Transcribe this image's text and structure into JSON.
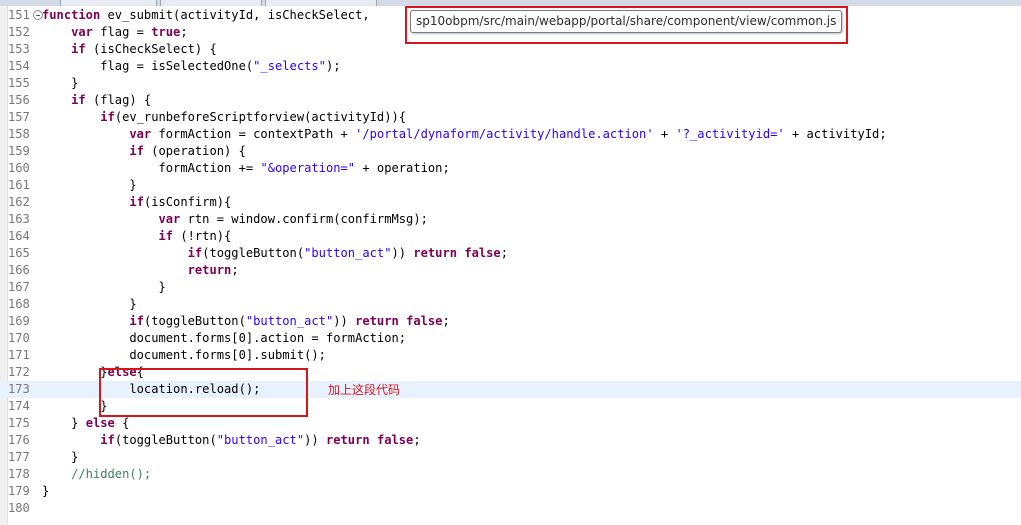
{
  "tooltip": {
    "path": "sp10obpm/src/main/webapp/portal/share/component/view/common.js"
  },
  "annotation": {
    "text": "加上这段代码"
  },
  "editor": {
    "lines": [
      {
        "num": "151",
        "fold": true,
        "tokens": [
          [
            "kw",
            "function"
          ],
          [
            "n",
            " ev_submit(activityId, isCheckSelect,"
          ]
        ]
      },
      {
        "num": "152",
        "tokens": [
          [
            "n",
            "    "
          ],
          [
            "kw",
            "var"
          ],
          [
            "n",
            " flag = "
          ],
          [
            "kw",
            "true"
          ],
          [
            "n",
            ";"
          ]
        ]
      },
      {
        "num": "153",
        "tokens": [
          [
            "n",
            "    "
          ],
          [
            "kw",
            "if"
          ],
          [
            "n",
            " (isCheckSelect) {"
          ]
        ]
      },
      {
        "num": "154",
        "tokens": [
          [
            "n",
            "        flag = isSelectedOne("
          ],
          [
            "str",
            "\"_selects\""
          ],
          [
            "n",
            ");"
          ]
        ]
      },
      {
        "num": "155",
        "tokens": [
          [
            "n",
            "    }"
          ]
        ]
      },
      {
        "num": "156",
        "tokens": [
          [
            "n",
            "    "
          ],
          [
            "kw",
            "if"
          ],
          [
            "n",
            " (flag) {"
          ]
        ]
      },
      {
        "num": "157",
        "tokens": [
          [
            "n",
            "        "
          ],
          [
            "kw",
            "if"
          ],
          [
            "n",
            "(ev_runbeforeScriptforview(activityId)){"
          ]
        ]
      },
      {
        "num": "158",
        "tokens": [
          [
            "n",
            "            "
          ],
          [
            "kw",
            "var"
          ],
          [
            "n",
            " formAction = contextPath + "
          ],
          [
            "str",
            "'/portal/dynaform/activity/handle.action'"
          ],
          [
            "n",
            " + "
          ],
          [
            "str",
            "'?_activityid='"
          ],
          [
            "n",
            " + activityId;"
          ]
        ]
      },
      {
        "num": "159",
        "tokens": [
          [
            "n",
            "            "
          ],
          [
            "kw",
            "if"
          ],
          [
            "n",
            " (operation) {"
          ]
        ]
      },
      {
        "num": "160",
        "tokens": [
          [
            "n",
            "                formAction += "
          ],
          [
            "str",
            "\"&operation=\""
          ],
          [
            "n",
            " + operation;"
          ]
        ]
      },
      {
        "num": "161",
        "tokens": [
          [
            "n",
            "            }"
          ]
        ]
      },
      {
        "num": "162",
        "tokens": [
          [
            "n",
            "            "
          ],
          [
            "kw",
            "if"
          ],
          [
            "n",
            "(isConfirm){"
          ]
        ]
      },
      {
        "num": "163",
        "tokens": [
          [
            "n",
            "                "
          ],
          [
            "kw",
            "var"
          ],
          [
            "n",
            " rtn = window.confirm(confirmMsg);"
          ]
        ]
      },
      {
        "num": "164",
        "tokens": [
          [
            "n",
            "                "
          ],
          [
            "kw",
            "if"
          ],
          [
            "n",
            " (!rtn){"
          ]
        ]
      },
      {
        "num": "165",
        "tokens": [
          [
            "n",
            "                    "
          ],
          [
            "kw",
            "if"
          ],
          [
            "n",
            "(toggleButton("
          ],
          [
            "str",
            "\"button_act\""
          ],
          [
            "n",
            ")) "
          ],
          [
            "kw",
            "return"
          ],
          [
            "n",
            " "
          ],
          [
            "kw",
            "false"
          ],
          [
            "n",
            ";"
          ]
        ]
      },
      {
        "num": "166",
        "tokens": [
          [
            "n",
            "                    "
          ],
          [
            "kw",
            "return"
          ],
          [
            "n",
            ";"
          ]
        ]
      },
      {
        "num": "167",
        "tokens": [
          [
            "n",
            "                }"
          ]
        ]
      },
      {
        "num": "168",
        "tokens": [
          [
            "n",
            "            }"
          ]
        ]
      },
      {
        "num": "169",
        "tokens": [
          [
            "n",
            "            "
          ],
          [
            "kw",
            "if"
          ],
          [
            "n",
            "(toggleButton("
          ],
          [
            "str",
            "\"button_act\""
          ],
          [
            "n",
            ")) "
          ],
          [
            "kw",
            "return"
          ],
          [
            "n",
            " "
          ],
          [
            "kw",
            "false"
          ],
          [
            "n",
            ";"
          ]
        ]
      },
      {
        "num": "170",
        "tokens": [
          [
            "n",
            "            document.forms[0].action = formAction;"
          ]
        ]
      },
      {
        "num": "171",
        "tokens": [
          [
            "n",
            "            document.forms[0].submit();"
          ]
        ]
      },
      {
        "num": "172",
        "tokens": [
          [
            "n",
            "        }"
          ],
          [
            "kw",
            "else"
          ],
          [
            "n",
            "{"
          ]
        ]
      },
      {
        "num": "173",
        "current": true,
        "tokens": [
          [
            "n",
            "            location.reload();"
          ]
        ]
      },
      {
        "num": "174",
        "tokens": [
          [
            "n",
            "        }"
          ]
        ]
      },
      {
        "num": "175",
        "tokens": [
          [
            "n",
            "    } "
          ],
          [
            "kw",
            "else"
          ],
          [
            "n",
            " {"
          ]
        ]
      },
      {
        "num": "176",
        "tokens": [
          [
            "n",
            "        "
          ],
          [
            "kw",
            "if"
          ],
          [
            "n",
            "(toggleButton("
          ],
          [
            "str",
            "\"button_act\""
          ],
          [
            "n",
            ")) "
          ],
          [
            "kw",
            "return"
          ],
          [
            "n",
            " "
          ],
          [
            "kw",
            "false"
          ],
          [
            "n",
            ";"
          ]
        ]
      },
      {
        "num": "177",
        "tokens": [
          [
            "n",
            "    }"
          ]
        ]
      },
      {
        "num": "178",
        "tokens": [
          [
            "n",
            "    "
          ],
          [
            "cm",
            "//hidden();"
          ]
        ]
      },
      {
        "num": "179",
        "tokens": [
          [
            "n",
            "}"
          ]
        ]
      },
      {
        "num": "180",
        "tokens": [
          [
            "n",
            ""
          ]
        ]
      }
    ]
  }
}
